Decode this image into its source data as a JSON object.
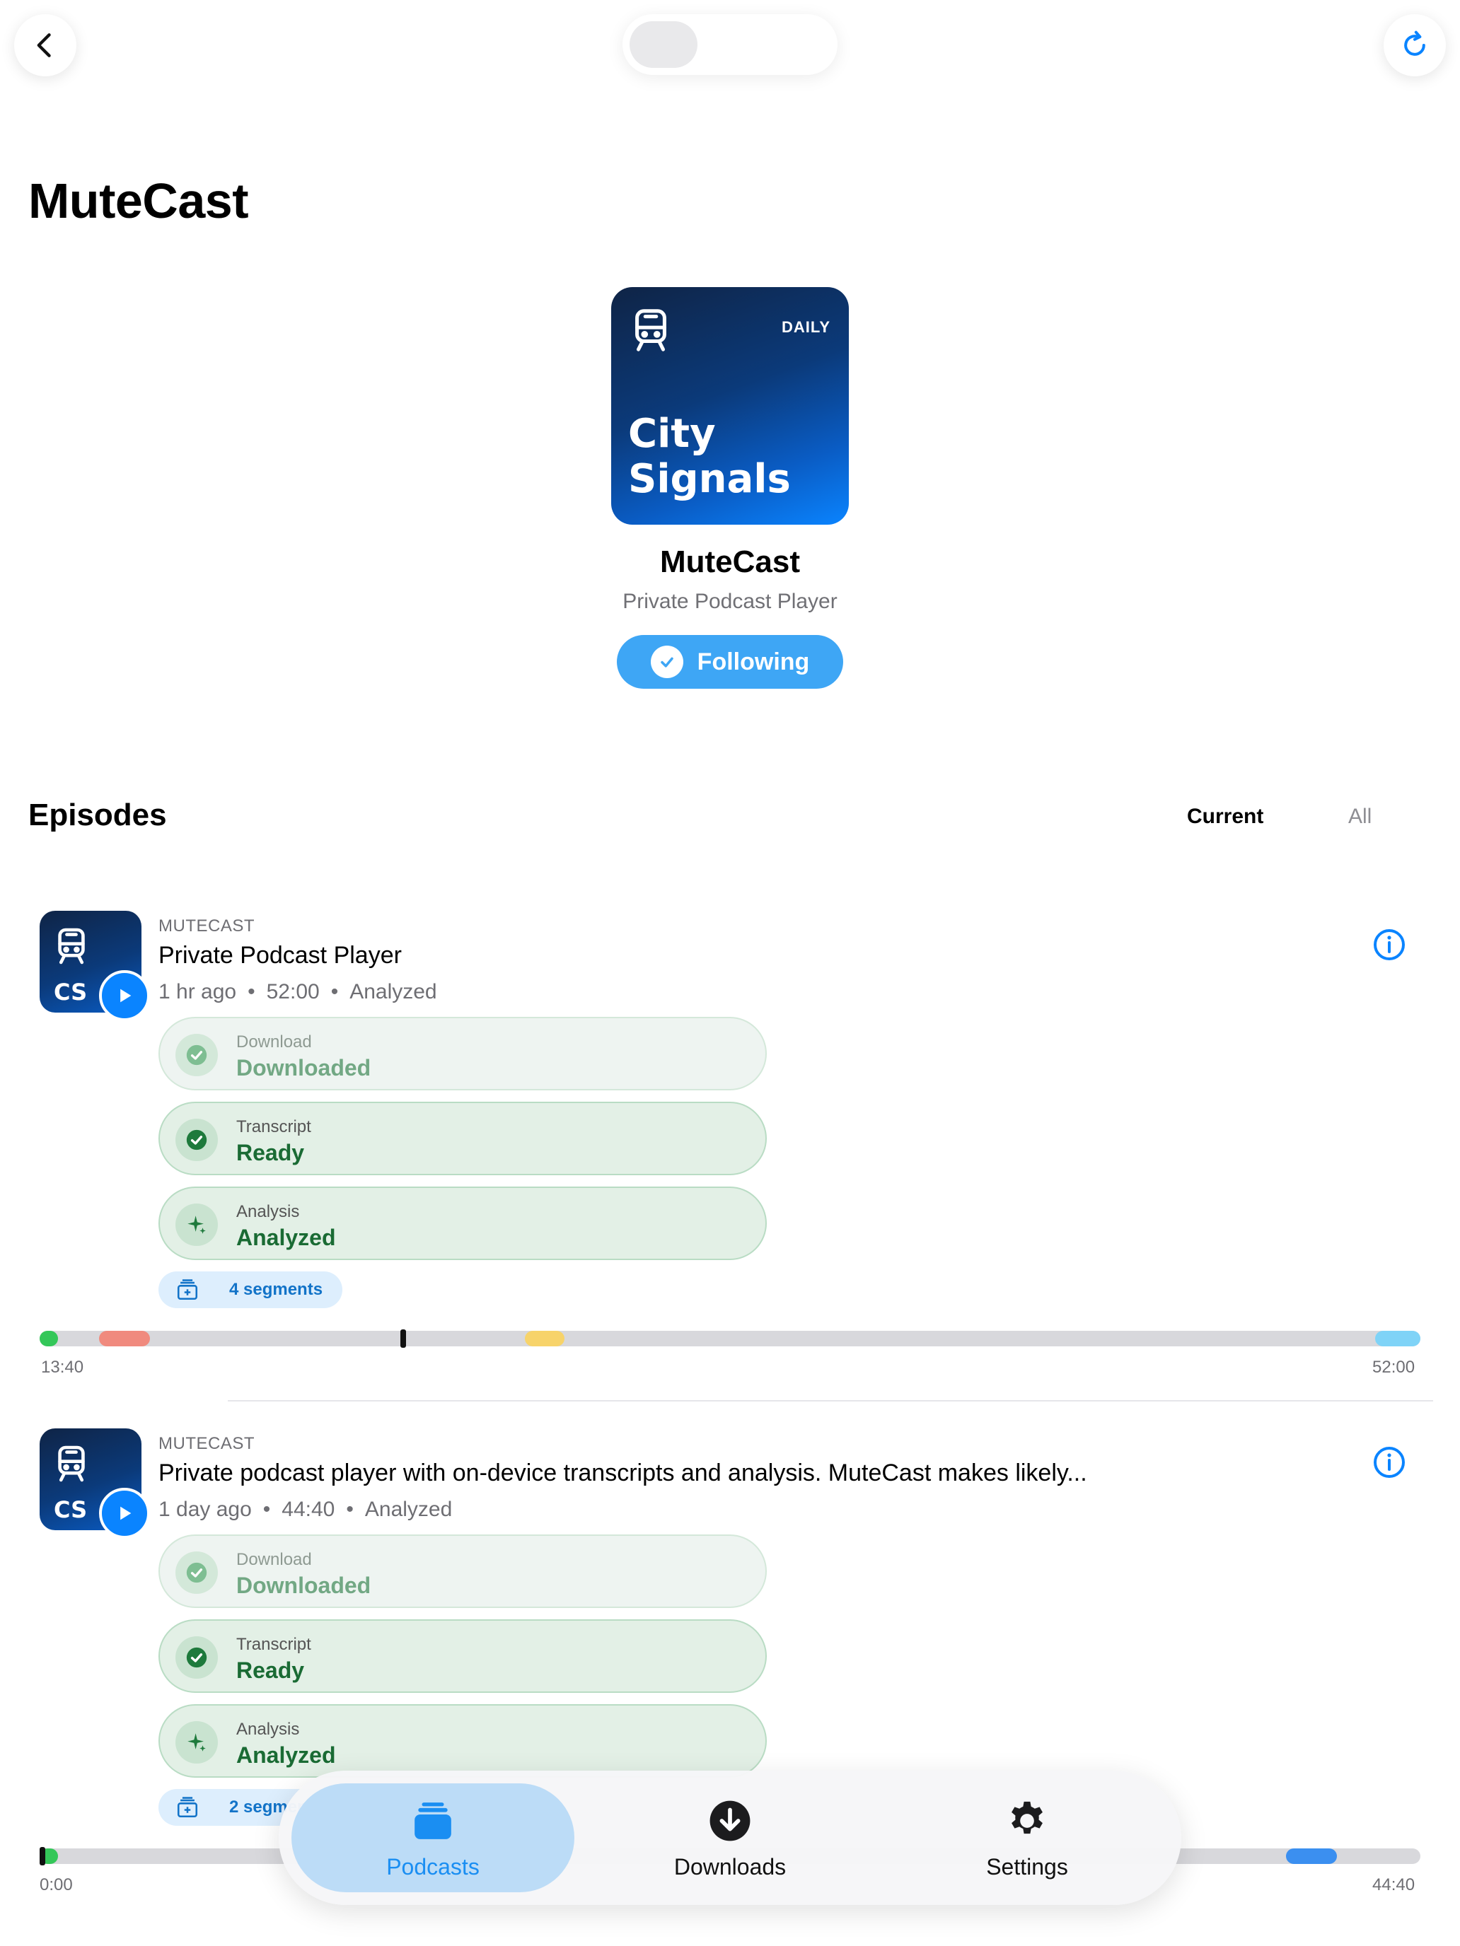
{
  "app": {
    "title": "MuteCast"
  },
  "podcast": {
    "artwork_badge": "DAILY",
    "artwork_title_line1": "City",
    "artwork_title_line2": "Signals",
    "name": "MuteCast",
    "subtitle": "Private Podcast Player",
    "follow_label": "Following"
  },
  "episodes_section": {
    "title": "Episodes",
    "filters": [
      "Current",
      "All"
    ],
    "selected_filter": "Current"
  },
  "episodes": [
    {
      "art_label": "CS",
      "source": "MUTECAST",
      "title": "Private Podcast Player",
      "age": "1 hr ago",
      "duration": "52:00",
      "state": "Analyzed",
      "download_label": "Download",
      "download_value": "Downloaded",
      "transcript_label": "Transcript",
      "transcript_value": "Ready",
      "analysis_label": "Analysis",
      "analysis_value": "Analyzed",
      "segments_label": "4 segments",
      "time_start": "13:40",
      "time_end": "52:00",
      "playhead_fraction": 0.263,
      "segment_colors": [
        "#34c759",
        "#f08a7e",
        "#f7d36a",
        "#7fd3f7"
      ]
    },
    {
      "art_label": "CS",
      "source": "MUTECAST",
      "title": "Private podcast player with on-device transcripts and analysis. MuteCast makes likely...",
      "age": "1 day ago",
      "duration": "44:40",
      "state": "Analyzed",
      "download_label": "Download",
      "download_value": "Downloaded",
      "transcript_label": "Transcript",
      "transcript_value": "Ready",
      "analysis_label": "Analysis",
      "analysis_value": "Analyzed",
      "segments_label": "2 segments",
      "time_start": "0:00",
      "time_end": "44:40",
      "playhead_fraction": 0.0,
      "segment_colors": [
        "#34c759",
        "#3b8ff0"
      ]
    }
  ],
  "tabbar": {
    "items": [
      "Podcasts",
      "Downloads",
      "Settings"
    ],
    "selected": "Podcasts"
  },
  "colors": {
    "accent": "#0a84ff",
    "follow_button": "#3ea6f5",
    "status_green": "#1a6b34",
    "status_pill_bg": "#e3f0e6"
  }
}
